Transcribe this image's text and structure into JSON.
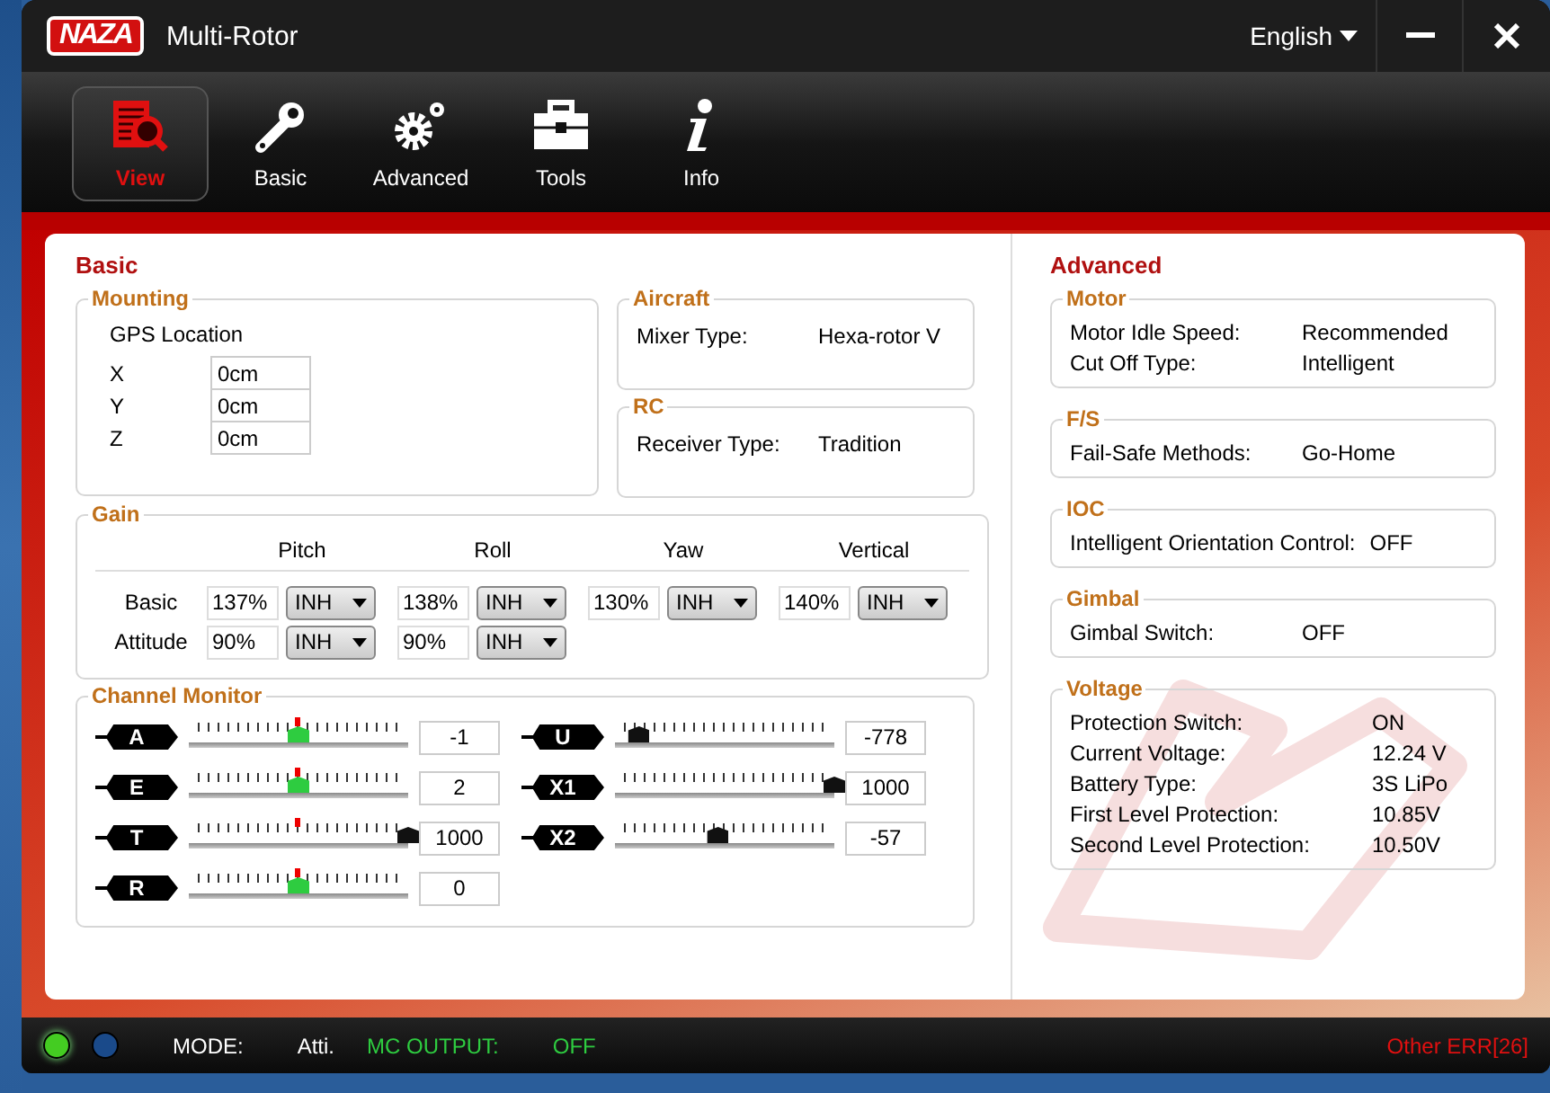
{
  "window": {
    "logo_text": "NAZA",
    "title": "Multi-Rotor",
    "language": "English",
    "controls": [
      {
        "kind": "minimize"
      },
      {
        "kind": "close"
      }
    ]
  },
  "tabs": [
    {
      "label": "View",
      "selected": true
    },
    {
      "label": "Basic",
      "selected": false
    },
    {
      "label": "Advanced",
      "selected": false
    },
    {
      "label": "Tools",
      "selected": false
    },
    {
      "label": "Info",
      "selected": false
    }
  ],
  "basic": {
    "title": "Basic",
    "mounting": {
      "title": "Mounting",
      "heading": "GPS Location",
      "fields": [
        {
          "label": "X",
          "value": "0cm"
        },
        {
          "label": "Y",
          "value": "0cm"
        },
        {
          "label": "Z",
          "value": "0cm"
        }
      ]
    },
    "aircraft": {
      "title": "Aircraft",
      "rows": [
        {
          "label": "Mixer Type:",
          "value": "Hexa-rotor V"
        }
      ]
    },
    "rc": {
      "title": "RC",
      "rows": [
        {
          "label": "Receiver Type:",
          "value": "Tradition"
        }
      ]
    },
    "gain": {
      "title": "Gain",
      "columns": [
        "Pitch",
        "Roll",
        "Yaw",
        "Vertical"
      ],
      "rows": [
        {
          "label": "Basic",
          "cells": [
            {
              "value": "137%",
              "mode": "INH"
            },
            {
              "value": "138%",
              "mode": "INH"
            },
            {
              "value": "130%",
              "mode": "INH"
            },
            {
              "value": "140%",
              "mode": "INH"
            }
          ]
        },
        {
          "label": "Attitude",
          "cells": [
            {
              "value": "90%",
              "mode": "INH"
            },
            {
              "value": "90%",
              "mode": "INH"
            }
          ]
        }
      ]
    },
    "channel_monitor": {
      "title": "Channel Monitor",
      "columns": [
        [
          {
            "name": "A",
            "level": 0.5,
            "center_mark": true,
            "color": "#2ecc40",
            "reading": "-1"
          },
          {
            "name": "E",
            "level": 0.5,
            "center_mark": true,
            "color": "#2ecc40",
            "reading": "2"
          },
          {
            "name": "T",
            "level": 1,
            "center_mark": true,
            "color": "#111111",
            "reading": "1000"
          },
          {
            "name": "R",
            "level": 0.5,
            "center_mark": true,
            "color": "#2ecc40",
            "reading": "0"
          }
        ],
        [
          {
            "name": "U",
            "level": 0.11,
            "center_mark": false,
            "color": "#111111",
            "reading": "-778"
          },
          {
            "name": "X1",
            "level": 1,
            "center_mark": false,
            "color": "#111111",
            "reading": "1000"
          },
          {
            "name": "X2",
            "level": 0.47,
            "center_mark": false,
            "color": "#111111",
            "reading": "-57"
          }
        ]
      ]
    }
  },
  "advanced": {
    "title": "Advanced",
    "groups": [
      {
        "title": "Motor",
        "rows": [
          {
            "label": "Motor Idle Speed:",
            "value": "Recommended"
          },
          {
            "label": "Cut Off Type:",
            "value": "Intelligent"
          }
        ]
      },
      {
        "title": "F/S",
        "rows": [
          {
            "label": "Fail-Safe Methods:",
            "value": "Go-Home"
          }
        ]
      },
      {
        "title": "IOC",
        "rows": [
          {
            "label": "Intelligent Orientation Control:",
            "value": "OFF"
          }
        ]
      },
      {
        "title": "Gimbal",
        "rows": [
          {
            "label": "Gimbal Switch:",
            "value": "OFF"
          }
        ]
      },
      {
        "title": "Voltage",
        "rows": [
          {
            "label": "Protection Switch:",
            "value": "ON"
          },
          {
            "label": "Current Voltage:",
            "value": "12.24 V"
          },
          {
            "label": "Battery Type:",
            "value": "3S LiPo"
          },
          {
            "label": "First Level Protection:",
            "value": "10.85V"
          },
          {
            "label": "Second Level Protection:",
            "value": "10.50V"
          }
        ]
      }
    ]
  },
  "status_bar": {
    "leds": [
      {
        "on": true,
        "color": "#44cc22"
      },
      {
        "on": false,
        "color": "#1a4a8a"
      }
    ],
    "items": [
      {
        "label": "MODE:",
        "value": "Atti.",
        "highlight": false
      },
      {
        "label": "MC OUTPUT:",
        "value": "OFF",
        "highlight": true
      }
    ],
    "error": "Other ERR[26]"
  }
}
